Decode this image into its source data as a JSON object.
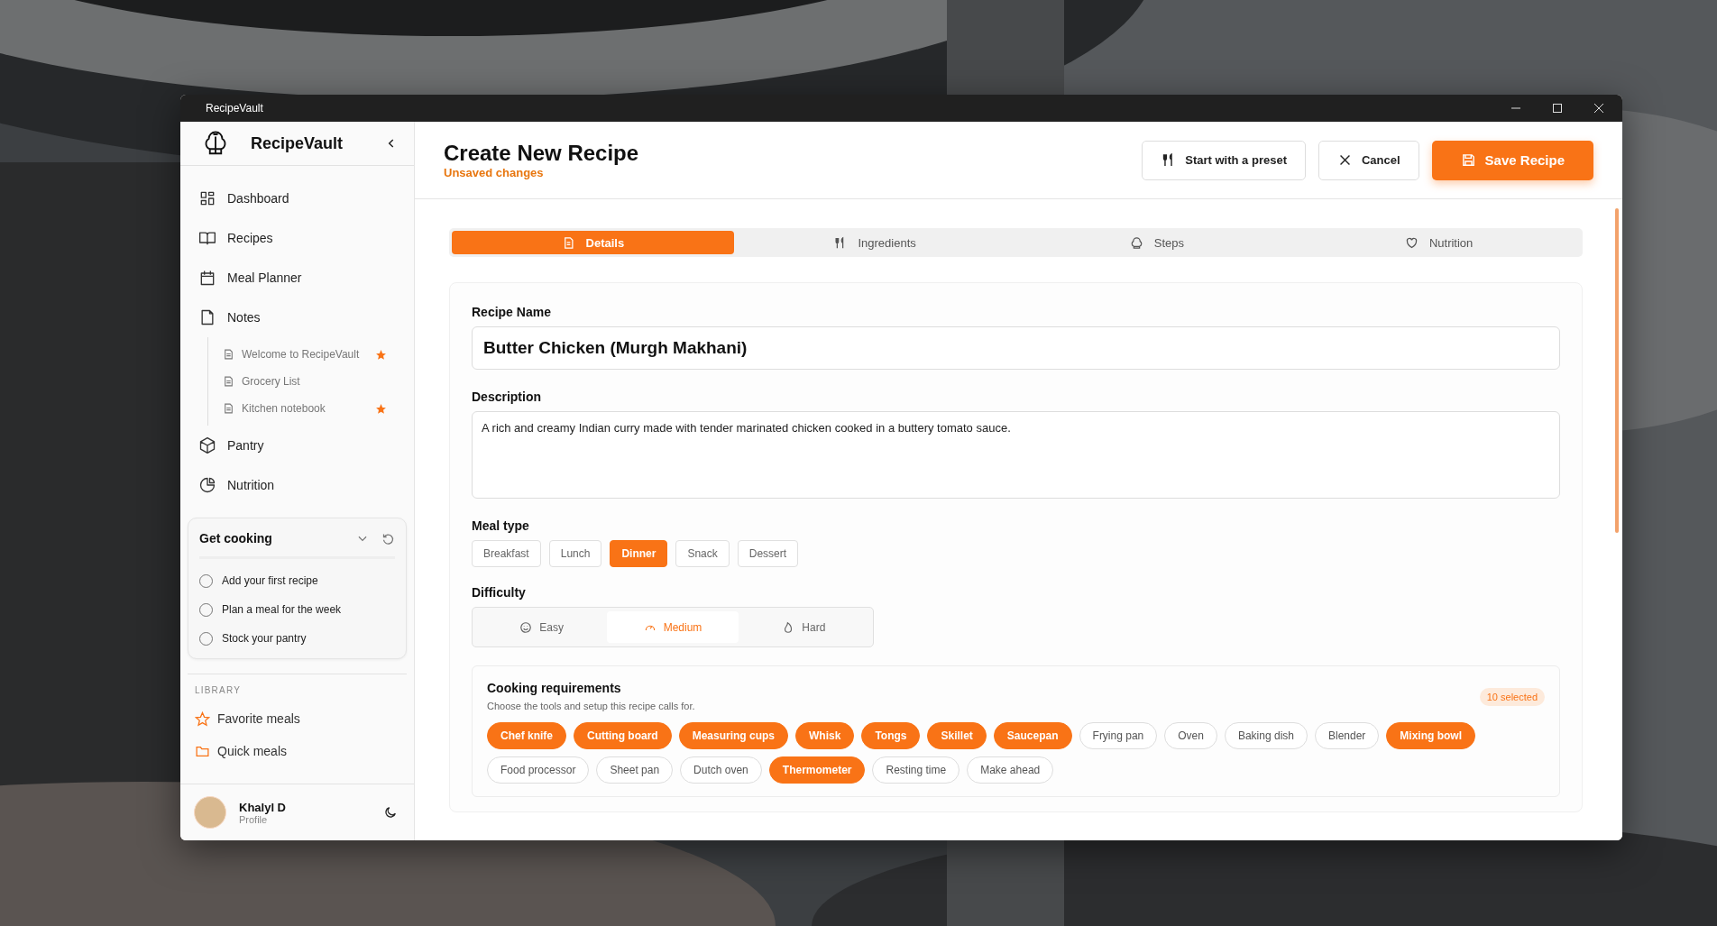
{
  "window": {
    "title": "RecipeVault"
  },
  "sidebar": {
    "brand": "RecipeVault",
    "nav": [
      {
        "label": "Dashboard"
      },
      {
        "label": "Recipes"
      },
      {
        "label": "Meal Planner"
      },
      {
        "label": "Notes",
        "children": [
          {
            "label": "Welcome to RecipeVault",
            "starred": true
          },
          {
            "label": "Grocery List",
            "starred": false
          },
          {
            "label": "Kitchen notebook",
            "starred": true
          }
        ]
      },
      {
        "label": "Pantry"
      },
      {
        "label": "Nutrition"
      }
    ],
    "checklist": {
      "title": "Get cooking",
      "items": [
        {
          "label": "Add your first recipe",
          "checked": false
        },
        {
          "label": "Plan a meal for the week",
          "checked": false
        },
        {
          "label": "Stock your pantry",
          "checked": false
        }
      ]
    },
    "library": {
      "heading": "LIBRARY",
      "items": [
        {
          "label": "Favorite meals"
        },
        {
          "label": "Quick meals"
        }
      ]
    },
    "profile": {
      "name": "Khalyl D",
      "subtitle": "Profile"
    }
  },
  "header": {
    "title": "Create New Recipe",
    "status": "Unsaved changes",
    "buttons": [
      {
        "label": "Start with a preset",
        "kind": "outline"
      },
      {
        "label": "Cancel",
        "kind": "outline"
      },
      {
        "label": "Save Recipe",
        "kind": "primary"
      }
    ]
  },
  "tabs": [
    {
      "label": "Details",
      "selected": true
    },
    {
      "label": "Ingredients",
      "selected": false
    },
    {
      "label": "Steps",
      "selected": false
    },
    {
      "label": "Nutrition",
      "selected": false
    }
  ],
  "form": {
    "name": {
      "label": "Recipe Name",
      "value": "Butter Chicken (Murgh Makhani)"
    },
    "description": {
      "label": "Description",
      "value": "A rich and creamy Indian curry made with tender marinated chicken cooked in a buttery tomato sauce."
    },
    "meal_type": {
      "label": "Meal type",
      "options": [
        {
          "label": "Breakfast",
          "selected": false
        },
        {
          "label": "Lunch",
          "selected": false
        },
        {
          "label": "Dinner",
          "selected": true
        },
        {
          "label": "Snack",
          "selected": false
        },
        {
          "label": "Dessert",
          "selected": false
        }
      ]
    },
    "difficulty": {
      "label": "Difficulty",
      "options": [
        {
          "label": "Easy",
          "selected": false
        },
        {
          "label": "Medium",
          "selected": true
        },
        {
          "label": "Hard",
          "selected": false
        }
      ]
    },
    "requirements": {
      "title": "Cooking requirements",
      "hint": "Choose the tools and setup this recipe calls for.",
      "count": "10 selected",
      "tools": [
        {
          "label": "Chef knife",
          "selected": true
        },
        {
          "label": "Cutting board",
          "selected": true
        },
        {
          "label": "Measuring cups",
          "selected": true
        },
        {
          "label": "Whisk",
          "selected": true
        },
        {
          "label": "Tongs",
          "selected": true
        },
        {
          "label": "Skillet",
          "selected": true
        },
        {
          "label": "Saucepan",
          "selected": true
        },
        {
          "label": "Frying pan",
          "selected": false
        },
        {
          "label": "Oven",
          "selected": false
        },
        {
          "label": "Baking dish",
          "selected": false
        },
        {
          "label": "Blender",
          "selected": false
        },
        {
          "label": "Mixing bowl",
          "selected": true
        },
        {
          "label": "Food processor",
          "selected": false
        },
        {
          "label": "Sheet pan",
          "selected": false
        },
        {
          "label": "Dutch oven",
          "selected": false
        },
        {
          "label": "Thermometer",
          "selected": true
        },
        {
          "label": "Resting time",
          "selected": false
        },
        {
          "label": "Make ahead",
          "selected": false
        }
      ]
    }
  }
}
